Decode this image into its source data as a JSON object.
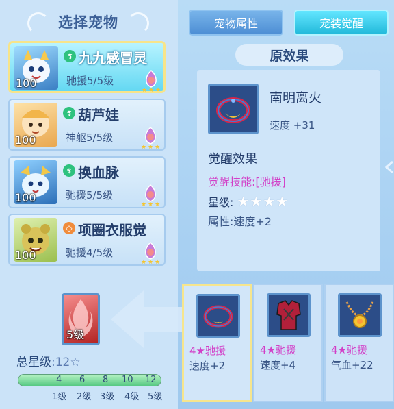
{
  "left": {
    "title": "选择宠物",
    "pets": [
      {
        "name": "九九感冒灵",
        "level": "100",
        "skill_level": "驰援5/5级",
        "badge_color": "#2ec27e",
        "selected": true
      },
      {
        "name": "葫芦娃",
        "level": "100",
        "skill_level": "神躯5/5级",
        "badge_color": "#2ec27e",
        "selected": false
      },
      {
        "name": "换血脉",
        "level": "100",
        "skill_level": "驰援5/5级",
        "badge_color": "#2ec27e",
        "selected": false
      },
      {
        "name": "项圈衣服觉",
        "level": "100",
        "skill_level": "驰援4/5级",
        "badge_color": "#f08c3c",
        "selected": false
      }
    ],
    "skill_box_level": "5级",
    "total_star_label": "总星级",
    "total_star_value": ":12☆",
    "progress": {
      "fraction": 1.0,
      "ticks": [
        "4",
        "6",
        "8",
        "10",
        "12"
      ],
      "levels": [
        "1级",
        "2级",
        "3级",
        "4级",
        "5级"
      ]
    }
  },
  "right": {
    "tabs": {
      "attributes": "宠物属性",
      "awaken": "宠装觉醒"
    },
    "effect_title": "原效果",
    "item": {
      "name": "南明离火",
      "speed": "速度 +31"
    },
    "awaken": {
      "title": "觉醒效果",
      "skill": "觉醒技能:[驰援]",
      "star_label": "星级:",
      "stars": "★★★★",
      "attr": "属性:速度+2"
    },
    "equips": [
      {
        "req": "4★驰援",
        "stat": "速度+2",
        "icon": "ring-icon",
        "selected": true
      },
      {
        "req": "4★驰援",
        "stat": "速度+4",
        "icon": "armor-icon",
        "selected": false
      },
      {
        "req": "4★驰援",
        "stat": "气血+22",
        "icon": "necklace-icon",
        "selected": false
      }
    ]
  },
  "colors": {
    "accent": "#22b9da",
    "highlight": "#f6e58d",
    "magenta": "#d23fc7"
  }
}
